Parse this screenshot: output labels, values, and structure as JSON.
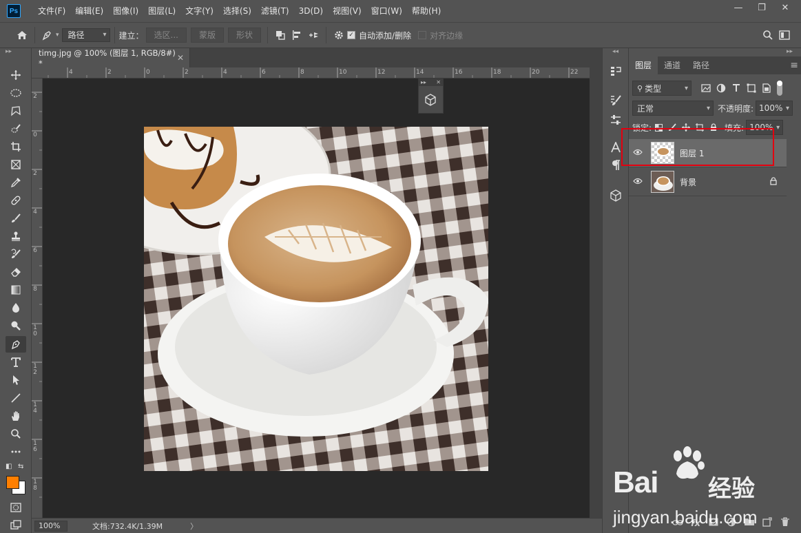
{
  "menubar": {
    "logo": "Ps",
    "items": [
      "文件(F)",
      "编辑(E)",
      "图像(I)",
      "图层(L)",
      "文字(Y)",
      "选择(S)",
      "滤镜(T)",
      "3D(D)",
      "视图(V)",
      "窗口(W)",
      "帮助(H)"
    ],
    "window_controls": [
      "—",
      "❐",
      "✕"
    ]
  },
  "options": {
    "mode": "路径",
    "build_label": "建立：",
    "buttons": [
      "选区...",
      "蒙版",
      "形状"
    ],
    "auto_add_delete": "自动添加/删除",
    "align_edges": "对齐边缘"
  },
  "document": {
    "tab_title": "timg.jpg @ 100% (图层 1, RGB/8#) *",
    "zoom": "100%",
    "info": "文档:732.4K/1.39M",
    "info_arrow": "〉",
    "ruler_h": [
      "4",
      "2",
      "0",
      "2",
      "4",
      "6",
      "8",
      "10",
      "12",
      "14",
      "16",
      "18",
      "20",
      "22"
    ],
    "ruler_v": [
      "2",
      "0",
      "2",
      "4",
      "6",
      "8",
      "1 0",
      "1 2",
      "1 4",
      "1 6",
      "1 8"
    ]
  },
  "layers_panel": {
    "tabs": [
      "图层",
      "通道",
      "路径"
    ],
    "menu_icon": "≡",
    "filter_kind": "类型",
    "blend_mode": "正常",
    "opacity_label": "不透明度:",
    "opacity_value": "100%",
    "lock_label": "锁定:",
    "fill_label": "填充:",
    "fill_value": "100%",
    "layers": [
      {
        "name": "图层 1",
        "locked": false,
        "selected": true
      },
      {
        "name": "背景",
        "locked": true,
        "selected": false
      }
    ],
    "bottom_icons": [
      "link",
      "fx",
      "mask",
      "adjust",
      "folder",
      "new",
      "trash"
    ],
    "fx_label": "fx"
  },
  "watermark": {
    "brand": "Bai",
    "brand2": "经验",
    "url": "jingyan.baidu.com"
  },
  "colors": {
    "foreground": "#ff7f00",
    "background": "#ffffff",
    "highlight": "#e3000f"
  }
}
